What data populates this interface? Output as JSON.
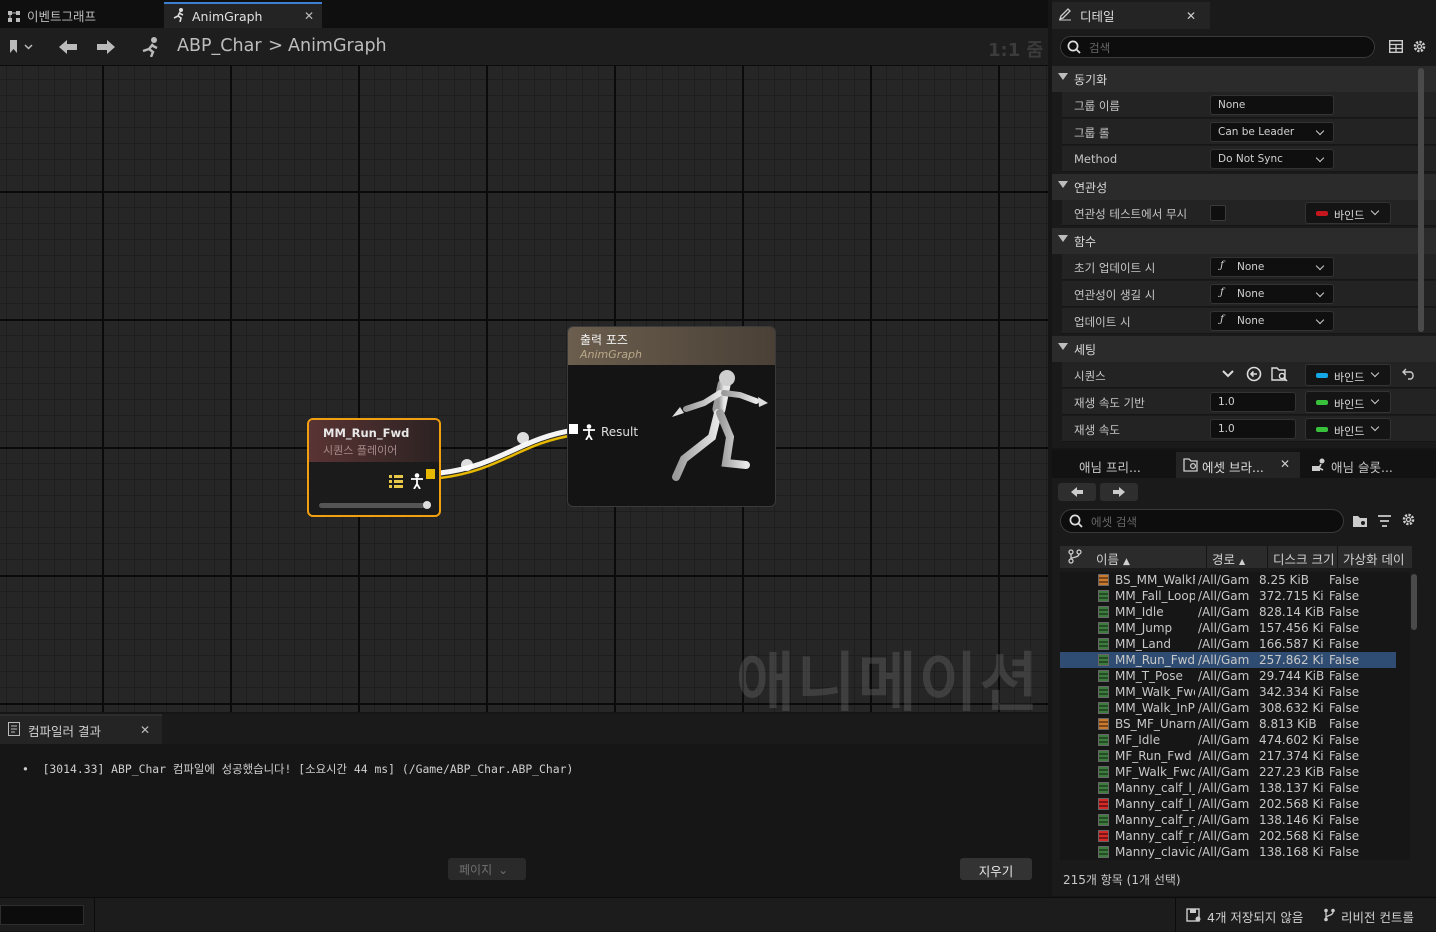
{
  "tabs": [
    {
      "label": "이벤트그래프"
    },
    {
      "label": "AnimGraph"
    }
  ],
  "toolbar": {
    "breadcrumb_root": "ABP_Char",
    "breadcrumb_sep": ">",
    "breadcrumb_leaf": "AnimGraph",
    "zoom": "1:1 줌"
  },
  "graph": {
    "watermark": "애니메이션",
    "seq_node": {
      "title": "MM_Run_Fwd",
      "subtitle": "시퀀스 플레이어"
    },
    "output_node": {
      "title": "출력 포즈",
      "subtitle": "AnimGraph",
      "pin": "Result"
    }
  },
  "compiler": {
    "tab": "컴파일러 결과",
    "message": "[3014.33] ABP_Char 컴파일에 성공했습니다! [소요시간 44 ms] (/Game/ABP_Char.ABP_Char)",
    "page_label": "페이지",
    "clear_label": "지우기"
  },
  "details": {
    "tab": "디테일",
    "search_placeholder": "검색",
    "sections": {
      "sync": "동기화",
      "relevancy": "연관성",
      "functions": "함수",
      "settings": "세팅"
    },
    "rows": {
      "group_name": {
        "label": "그룹 이름",
        "value": "None"
      },
      "group_role": {
        "label": "그룹 롤",
        "value": "Can be Leader"
      },
      "method": {
        "label": "Method",
        "value": "Do Not Sync"
      },
      "ignore_relevancy": {
        "label": "연관성 테스트에서 무시",
        "bind": "바인드"
      },
      "initial_update": {
        "label": "초기 업데이트 시",
        "value": "None"
      },
      "become_relevant": {
        "label": "연관성이 생길 시",
        "value": "None"
      },
      "on_update": {
        "label": "업데이트 시",
        "value": "None"
      },
      "sequence": {
        "label": "시퀀스",
        "bind": "바인드"
      },
      "play_rate_basis": {
        "label": "재생 속도 기반",
        "value": "1.0",
        "bind": "바인드"
      },
      "play_rate": {
        "label": "재생 속도",
        "value": "1.0",
        "bind": "바인드"
      }
    },
    "colors": {
      "red_bind": "#c4161c",
      "blue_bind": "#14a7e8",
      "green_bind": "#38c23c"
    }
  },
  "assets": {
    "tabs": [
      "애님 프리...",
      "에셋 브라...",
      "애님 슬롯..."
    ],
    "search_placeholder": "에셋 검색",
    "columns": [
      "이름",
      "경로",
      "디스크 크기",
      "가상화 데이"
    ],
    "rows": [
      {
        "name": "BS_MM_WalkRu",
        "path": "/All/Gam",
        "size": "8.25 KiB",
        "virt": "False",
        "icon": "orange"
      },
      {
        "name": "MM_Fall_Loop",
        "path": "/All/Gam",
        "size": "372.715 Ki",
        "virt": "False",
        "icon": "green"
      },
      {
        "name": "MM_Idle",
        "path": "/All/Gam",
        "size": "828.14 KiB",
        "virt": "False",
        "icon": "green"
      },
      {
        "name": "MM_Jump",
        "path": "/All/Gam",
        "size": "157.456 Ki",
        "virt": "False",
        "icon": "green"
      },
      {
        "name": "MM_Land",
        "path": "/All/Gam",
        "size": "166.587 Ki",
        "virt": "False",
        "icon": "green"
      },
      {
        "name": "MM_Run_Fwd",
        "path": "/All/Gam",
        "size": "257.862 Ki",
        "virt": "False",
        "icon": "green",
        "selected": true
      },
      {
        "name": "MM_T_Pose",
        "path": "/All/Gam",
        "size": "29.744 KiB",
        "virt": "False",
        "icon": "green"
      },
      {
        "name": "MM_Walk_Fwd",
        "path": "/All/Gam",
        "size": "342.334 Ki",
        "virt": "False",
        "icon": "green"
      },
      {
        "name": "MM_Walk_InPla",
        "path": "/All/Gam",
        "size": "308.632 Ki",
        "virt": "False",
        "icon": "green"
      },
      {
        "name": "BS_MF_Unarme",
        "path": "/All/Gam",
        "size": "8.813 KiB",
        "virt": "False",
        "icon": "orange"
      },
      {
        "name": "MF_Idle",
        "path": "/All/Gam",
        "size": "474.602 Ki",
        "virt": "False",
        "icon": "green"
      },
      {
        "name": "MF_Run_Fwd",
        "path": "/All/Gam",
        "size": "217.374 Ki",
        "virt": "False",
        "icon": "green"
      },
      {
        "name": "MF_Walk_Fwd",
        "path": "/All/Gam",
        "size": "227.23 KiB",
        "virt": "False",
        "icon": "green"
      },
      {
        "name": "Manny_calf_l_ar",
        "path": "/All/Gam",
        "size": "138.137 Ki",
        "virt": "False",
        "icon": "green"
      },
      {
        "name": "Manny_calf_l_pc",
        "path": "/All/Gam",
        "size": "202.568 Ki",
        "virt": "False",
        "icon": "red"
      },
      {
        "name": "Manny_calf_r_a",
        "path": "/All/Gam",
        "size": "138.146 Ki",
        "virt": "False",
        "icon": "green"
      },
      {
        "name": "Manny_calf_r_p",
        "path": "/All/Gam",
        "size": "202.568 Ki",
        "virt": "False",
        "icon": "red"
      },
      {
        "name": "Manny_clavicle",
        "path": "/All/Gam",
        "size": "138.168 Ki",
        "virt": "False",
        "icon": "green"
      }
    ],
    "footer": "215개 항목 (1개 선택)"
  },
  "statusbar": {
    "unsaved": "4개 저장되지 않음",
    "revision": "리비전 컨트롤"
  }
}
